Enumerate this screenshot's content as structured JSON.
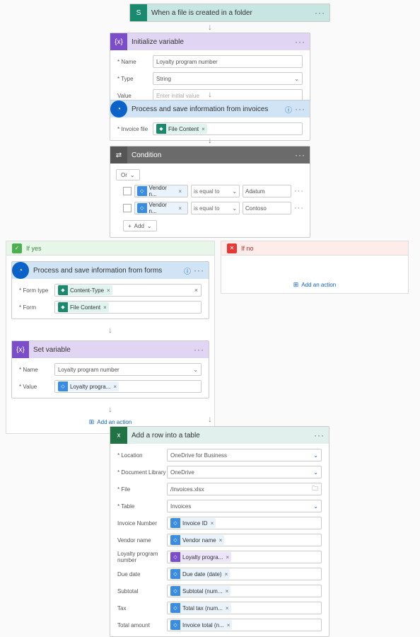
{
  "steps": {
    "trigger": {
      "title": "When a file is created in a folder",
      "icon": "S"
    },
    "initVar": {
      "title": "Initialize variable",
      "icon": "{x}",
      "name_label": "Name",
      "name_value": "Loyalty program number",
      "type_label": "Type",
      "type_value": "String",
      "value_label": "Value",
      "value_placeholder": "Enter initial value"
    },
    "processInvoices": {
      "title": "Process and save information from invoices",
      "fieldLabel": "Invoice file",
      "chip": {
        "label": "File Content"
      }
    },
    "condition": {
      "title": "Condition",
      "logic": "Or",
      "rows": [
        {
          "token": "Vendor n...",
          "op": "is equal to",
          "value": "Adatum"
        },
        {
          "token": "Vendor n...",
          "op": "is equal to",
          "value": "Contoso"
        }
      ],
      "addLabel": "Add"
    },
    "branches": {
      "yes": {
        "title": "If yes"
      },
      "no": {
        "title": "If no",
        "addAction": "Add an action"
      }
    },
    "processForms": {
      "title": "Process and save information from  forms",
      "formType": {
        "label": "Form type",
        "chip": "Content-Type"
      },
      "form": {
        "label": "Form",
        "chip": "File Content"
      }
    },
    "setVar": {
      "title": "Set variable",
      "icon": "{x}",
      "name_label": "Name",
      "name_value": "Loyalty program number",
      "value_label": "Value",
      "chip": "Loyalty progra..."
    },
    "addActionLabel": "Add an action",
    "excel": {
      "title": "Add a row into a table",
      "location": {
        "label": "Location",
        "value": "OneDrive for Business"
      },
      "docLib": {
        "label": "Document Library",
        "value": "OneDrive"
      },
      "file": {
        "label": "File",
        "value": "/Invoices.xlsx"
      },
      "table": {
        "label": "Table",
        "value": "Invoices"
      },
      "fields": [
        {
          "label": "Invoice Number",
          "chip": "Invoice ID"
        },
        {
          "label": "Vendor name",
          "chip": "Vendor name"
        },
        {
          "label": "Loyalty program number",
          "chip": "Loyalty progra...",
          "purple": true
        },
        {
          "label": "Due date",
          "chip": "Due date (date)"
        },
        {
          "label": "Subtotal",
          "chip": "Subtotal (num..."
        },
        {
          "label": "Tax",
          "chip": "Total tax (num..."
        },
        {
          "label": "Total amount",
          "chip": "Invoice total (n..."
        }
      ]
    }
  },
  "colors": {
    "spGreen": "#1a8a6e",
    "varPurple": "#7b4dc9",
    "aiBlue": "#0b62c9",
    "condGrey": "#6b6b6b",
    "excelGreen": "#217346",
    "chipTeal": "#1a8a6e",
    "chipBlue": "#3a8dde",
    "chipPurple": "#7b4dc9"
  }
}
